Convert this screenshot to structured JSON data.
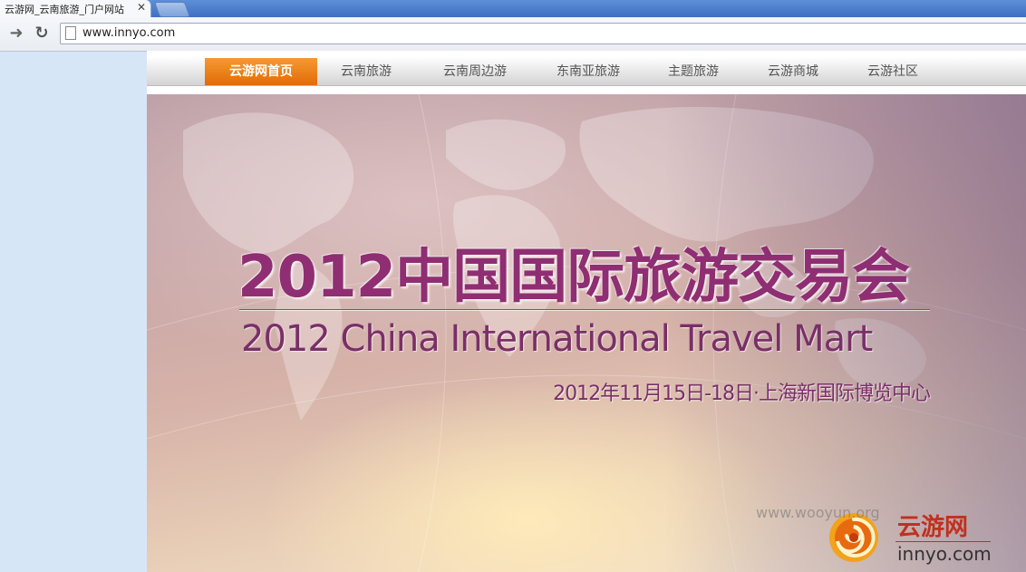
{
  "browser": {
    "tab_title": "云游网_云南旅游_门户网站",
    "close_glyph": "✕",
    "back_glyph": "➜",
    "reload_glyph": "↻",
    "url": "www.innyo.com"
  },
  "nav": {
    "items": [
      {
        "label": "云游网首页",
        "active": true
      },
      {
        "label": "云南旅游"
      },
      {
        "label": "云南周边游"
      },
      {
        "label": "东南亚旅游"
      },
      {
        "label": "主题旅游"
      },
      {
        "label": "云游商城"
      },
      {
        "label": "云游社区"
      }
    ]
  },
  "banner": {
    "title_cn": "2012中国国际旅游交易会",
    "title_en": "2012 China International Travel Mart",
    "date_venue": "2012年11月15日-18日·上海新国际博览中心"
  },
  "logo": {
    "name_cn": "云游网",
    "domain": "innyo.com"
  },
  "watermark": "www.wooyun.org",
  "colors": {
    "active_nav": "#e36b05",
    "banner_text": "#8f2e72",
    "logo_red": "#c0311e"
  }
}
